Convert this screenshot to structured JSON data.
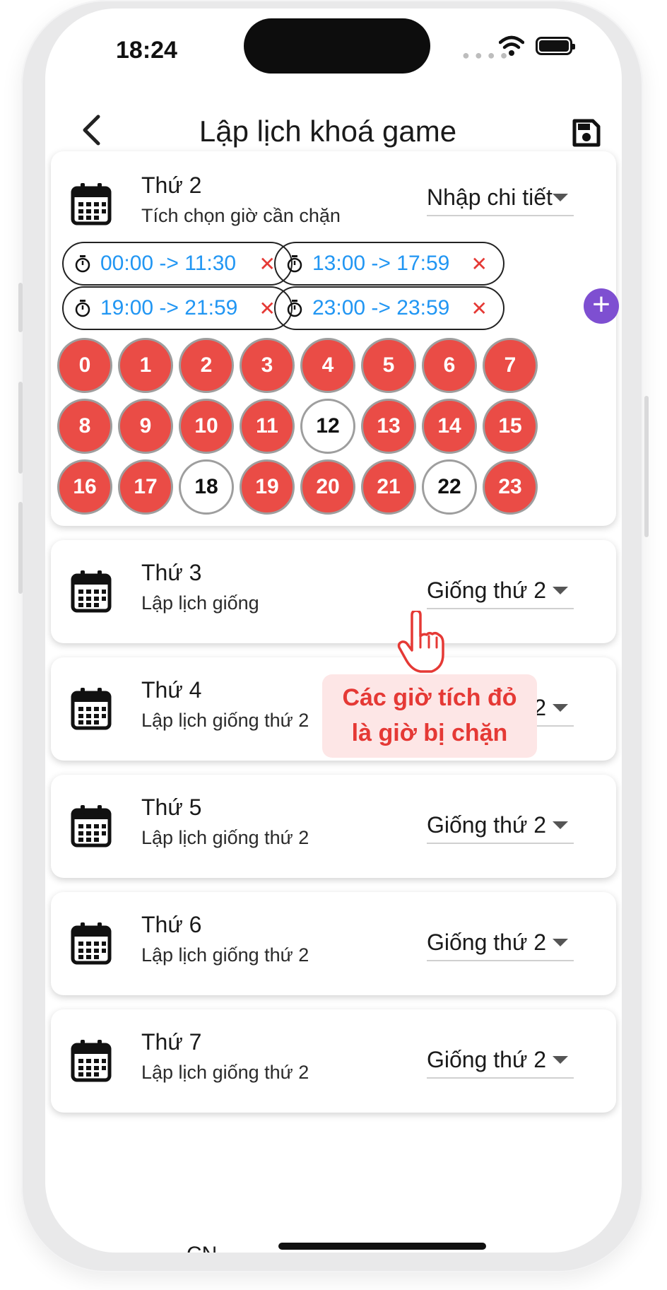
{
  "status_bar": {
    "time": "18:24"
  },
  "header": {
    "title": "Lập lịch khoá game"
  },
  "monday": {
    "name": "Thứ 2",
    "subtitle": "Tích chọn giờ cần chặn",
    "mode": "Nhập chi tiết",
    "ranges": [
      "00:00 -> 11:30",
      "13:00 -> 17:59",
      "19:00 -> 21:59",
      "23:00 -> 23:59"
    ],
    "remove_glyph": "✕",
    "add_glyph": "+",
    "hours": [
      {
        "label": "0",
        "blocked": true
      },
      {
        "label": "1",
        "blocked": true
      },
      {
        "label": "2",
        "blocked": true
      },
      {
        "label": "3",
        "blocked": true
      },
      {
        "label": "4",
        "blocked": true
      },
      {
        "label": "5",
        "blocked": true
      },
      {
        "label": "6",
        "blocked": true
      },
      {
        "label": "7",
        "blocked": true
      },
      {
        "label": "8",
        "blocked": true
      },
      {
        "label": "9",
        "blocked": true
      },
      {
        "label": "10",
        "blocked": true
      },
      {
        "label": "11",
        "blocked": true
      },
      {
        "label": "12",
        "blocked": false
      },
      {
        "label": "13",
        "blocked": true
      },
      {
        "label": "14",
        "blocked": true
      },
      {
        "label": "15",
        "blocked": true
      },
      {
        "label": "16",
        "blocked": true
      },
      {
        "label": "17",
        "blocked": true
      },
      {
        "label": "18",
        "blocked": false
      },
      {
        "label": "19",
        "blocked": true
      },
      {
        "label": "20",
        "blocked": true
      },
      {
        "label": "21",
        "blocked": true
      },
      {
        "label": "22",
        "blocked": false
      },
      {
        "label": "23",
        "blocked": true
      }
    ]
  },
  "other_days": [
    {
      "name": "Thứ 3",
      "subtitle": "Lập lịch giống",
      "mode": "Giống thứ 2"
    },
    {
      "name": "Thứ 4",
      "subtitle": "Lập lịch giống thứ 2",
      "mode": "Giống thứ 2"
    },
    {
      "name": "Thứ 5",
      "subtitle": "Lập lịch giống thứ 2",
      "mode": "Giống thứ 2"
    },
    {
      "name": "Thứ 6",
      "subtitle": "Lập lịch giống thứ 2",
      "mode": "Giống thứ 2"
    },
    {
      "name": "Thứ 7",
      "subtitle": "Lập lịch giống thứ 2",
      "mode": "Giống thứ 2"
    }
  ],
  "peek_day": "CN",
  "callout": {
    "line1": "Các giờ tích đỏ",
    "line2": "là  giờ bị chặn"
  },
  "colors": {
    "blocked": "#ea4c46",
    "range_text": "#2196f3",
    "remove": "#e53935",
    "add_button": "#7e4fd1",
    "callout_bg": "#fde6e6"
  }
}
